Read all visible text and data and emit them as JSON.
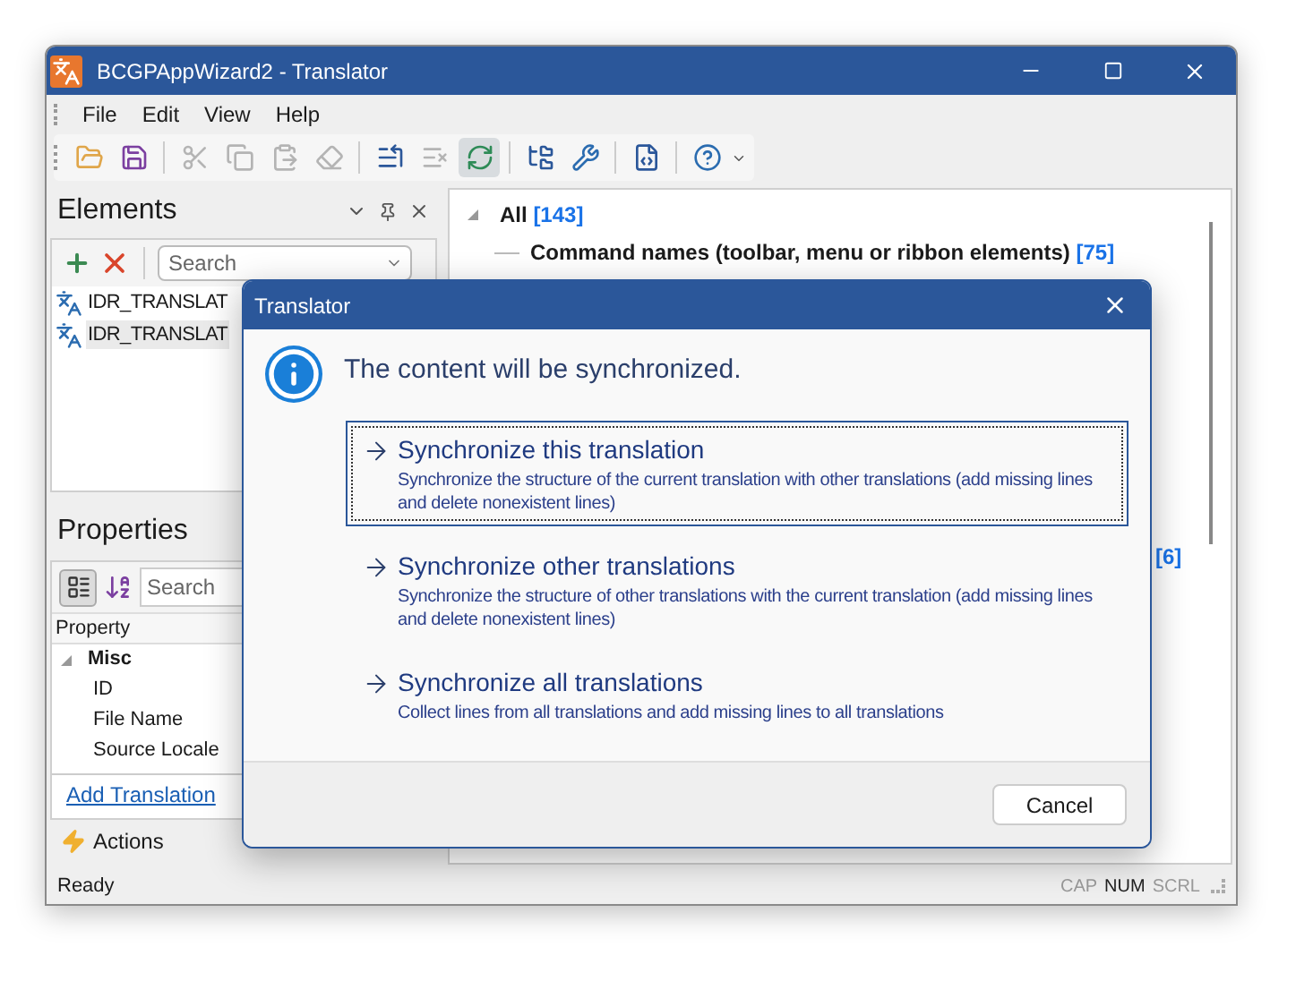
{
  "window": {
    "title": "BCGPAppWizard2 - Translator"
  },
  "menu": [
    "File",
    "Edit",
    "View",
    "Help"
  ],
  "toolbar": [
    {
      "kind": "open",
      "disabled": false,
      "pressed": false
    },
    {
      "kind": "save",
      "disabled": false,
      "pressed": false
    },
    {
      "kind": "separator"
    },
    {
      "kind": "cut",
      "disabled": true,
      "pressed": false
    },
    {
      "kind": "copy",
      "disabled": true,
      "pressed": false
    },
    {
      "kind": "paste",
      "disabled": true,
      "pressed": false
    },
    {
      "kind": "erase",
      "disabled": true,
      "pressed": false
    },
    {
      "kind": "separator"
    },
    {
      "kind": "add-line",
      "disabled": false,
      "pressed": false
    },
    {
      "kind": "delete-line",
      "disabled": true,
      "pressed": false
    },
    {
      "kind": "sync",
      "disabled": false,
      "pressed": true
    },
    {
      "kind": "separator"
    },
    {
      "kind": "tree",
      "disabled": false,
      "pressed": false
    },
    {
      "kind": "wrench",
      "disabled": false,
      "pressed": false
    },
    {
      "kind": "separator"
    },
    {
      "kind": "document",
      "disabled": false,
      "pressed": false
    },
    {
      "kind": "separator"
    },
    {
      "kind": "help",
      "disabled": false,
      "pressed": false
    }
  ],
  "elements_panel": {
    "title": "Elements",
    "search": {
      "placeholder": "Search"
    },
    "items": [
      {
        "label": "IDR_TRANSLAT",
        "selected": false
      },
      {
        "label": "IDR_TRANSLAT",
        "selected": true
      }
    ]
  },
  "properties_panel": {
    "title": "Properties",
    "search": {
      "placeholder": "Search"
    },
    "column": "Property",
    "groups": [
      {
        "label": "Misc",
        "expanded": true,
        "children": [
          {
            "label": "ID"
          },
          {
            "label": "File Name"
          },
          {
            "label": "Source Locale"
          }
        ]
      }
    ],
    "link": "Add Translation",
    "actions": "Actions"
  },
  "tree": {
    "label": "All",
    "count": "[143]",
    "expanded": true,
    "children": [
      {
        "label": "Command names (toolbar, menu or ribbon elements)",
        "count": "[75]"
      }
    ],
    "partial_count": "[6]"
  },
  "status_bar": {
    "text": "Ready",
    "indicators": [
      {
        "label": "CAP",
        "on": false
      },
      {
        "label": "NUM",
        "on": true
      },
      {
        "label": "SCRL",
        "on": false
      }
    ]
  },
  "dialog": {
    "title": "Translator",
    "message": "The content will be synchronized.",
    "options": [
      {
        "title": "Synchronize this translation",
        "description": "Synchronize the structure of the current translation with other translations (add missing lines and delete nonexistent lines)",
        "selected": true
      },
      {
        "title": "Synchronize other translations",
        "description": "Synchronize the structure of other translations with the current translation (add missing lines and delete nonexistent lines)",
        "selected": false
      },
      {
        "title": "Synchronize all translations",
        "description": "Collect lines from all translations and add missing lines to all translations",
        "selected": false
      }
    ],
    "button": "Cancel"
  }
}
